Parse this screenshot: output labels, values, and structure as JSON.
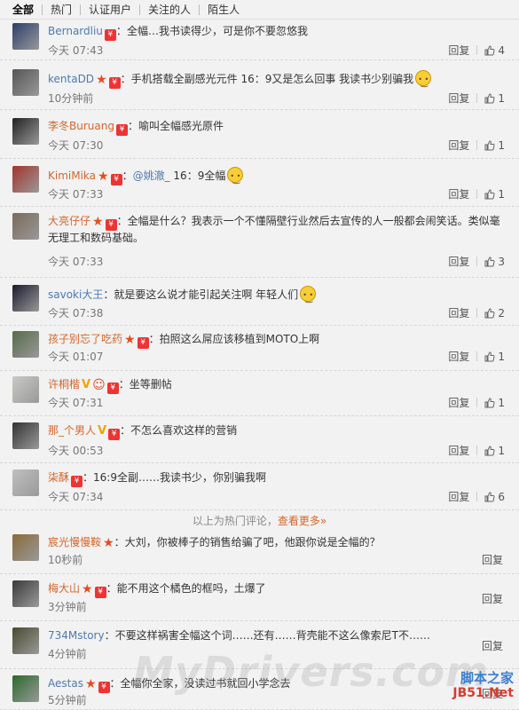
{
  "tabs": [
    "全部",
    "热门",
    "认证用户",
    "关注的人",
    "陌生人"
  ],
  "hot_comments": [
    {
      "name": "Bernardliu",
      "name_color": "blue",
      "badges": [
        "vip"
      ],
      "prefix": "：",
      "text": "全幅…我书读得少，可是你不要忽悠我",
      "emoji": false,
      "time": "今天 07:43",
      "reply": "回复",
      "likes": "4",
      "avatar_color": "#2c3e6b"
    },
    {
      "name": "kentaDD",
      "name_color": "blue",
      "badges": [
        "star",
        "vip"
      ],
      "prefix": "：",
      "text": "手机搭载全副感光元件 16：9又是怎么回事 我读书少别骗我",
      "emoji": true,
      "time": "10分钟前",
      "reply": "回复",
      "likes": "1",
      "avatar_color": "#555"
    },
    {
      "name": "李冬Buruang",
      "name_color": "orange",
      "badges": [
        "vip"
      ],
      "prefix": "：",
      "text": "喻叫全幅感光原件",
      "emoji": false,
      "time": "今天 07:30",
      "reply": "回复",
      "likes": "1",
      "avatar_color": "#222"
    },
    {
      "name": "KimiMika",
      "name_color": "orange",
      "badges": [
        "star",
        "vip"
      ],
      "prefix": "：",
      "mention": "@姚澈_",
      "text": " 16：9全幅",
      "emoji": true,
      "time": "今天 07:33",
      "reply": "回复",
      "likes": "1",
      "avatar_color": "#a3332a"
    },
    {
      "name": "大亮仔仔",
      "name_color": "orange",
      "badges": [
        "star",
        "vip"
      ],
      "prefix": "：",
      "text": "全幅是什么？我表示一个不懂隔壁行业然后去宣传的人一般都会闹笑话。类似毫无理工和数码基础。",
      "emoji": false,
      "time": "今天 07:33",
      "reply": "回复",
      "likes": "3",
      "avatar_color": "#7a6a5a"
    },
    {
      "name": "savoki大王",
      "name_color": "blue",
      "badges": [],
      "prefix": "：",
      "text": "就是要这么说才能引起关注啊 年轻人们",
      "emoji": true,
      "time": "今天 07:38",
      "reply": "回复",
      "likes": "2",
      "avatar_color": "#1a1a2e"
    },
    {
      "name": "孩子别忘了吃药",
      "name_color": "orange",
      "badges": [
        "star",
        "vip"
      ],
      "prefix": "：",
      "text": "拍照这么屌应该移植到MOTO上啊",
      "emoji": false,
      "time": "今天 01:07",
      "reply": "回复",
      "likes": "1",
      "avatar_color": "#556b4a"
    },
    {
      "name": "许桐楷",
      "name_color": "orange",
      "badges": [
        "v",
        "face",
        "vip"
      ],
      "prefix": "：",
      "text": "坐等删帖",
      "emoji": false,
      "time": "今天 07:31",
      "reply": "回复",
      "likes": "1",
      "avatar_color": "#c9c9c4"
    },
    {
      "name": "那_个男人",
      "name_color": "orange",
      "badges": [
        "v",
        "vip"
      ],
      "prefix": "：",
      "text": "不怎么喜欢这样的营销",
      "emoji": false,
      "time": "今天 00:53",
      "reply": "回复",
      "likes": "1",
      "avatar_color": "#333"
    },
    {
      "name": "柒酥",
      "name_color": "orange",
      "badges": [
        "vip"
      ],
      "prefix": "：",
      "text": "16:9全副……我读书少，你别骗我啊",
      "emoji": false,
      "time": "今天 07:34",
      "reply": "回复",
      "likes": "6",
      "avatar_color": "#bfbfbf"
    }
  ],
  "divider": {
    "text": "以上为热门评论，",
    "link": "查看更多»"
  },
  "recent_comments": [
    {
      "name": "宸光慢慢鞍",
      "name_color": "orange",
      "badges": [
        "star"
      ],
      "prefix": "：",
      "text": "大刘，你被棒子的销售给骗了吧，他跟你说是全幅的？",
      "emoji": false,
      "time": "10秒前",
      "reply": "回复",
      "likes": "",
      "avatar_color": "#8a6a3a"
    },
    {
      "name": "梅大山",
      "name_color": "orange",
      "badges": [
        "star",
        "vip"
      ],
      "prefix": "：",
      "text": "能不用这个橘色的框吗，土爆了",
      "emoji": false,
      "time": "3分钟前",
      "reply": "回复",
      "likes": "",
      "avatar_color": "#3a3a3a"
    },
    {
      "name": "734Mstory",
      "name_color": "blue",
      "badges": [],
      "prefix": "：",
      "text": "不要这样祸害全幅这个词……还有……背壳能不这么像索尼T不……",
      "emoji": false,
      "time": "4分钟前",
      "reply": "回复",
      "likes": "",
      "avatar_color": "#4a4a30"
    },
    {
      "name": "Aestas",
      "name_color": "blue",
      "badges": [
        "star",
        "vip"
      ],
      "prefix": "：",
      "text": "全幅你全家，没读过书就回小学念去",
      "emoji": false,
      "time": "5分钟前",
      "reply": "回复",
      "likes": "",
      "avatar_color": "#2a6a2a"
    }
  ],
  "watermark": "MyDrivers.com",
  "brand": {
    "line1": "脚本之家",
    "line2": "JB51.Net"
  },
  "colors": {
    "accent_orange": "#d4662b",
    "link_blue": "#4d79b3",
    "vip_red": "#e33333"
  }
}
